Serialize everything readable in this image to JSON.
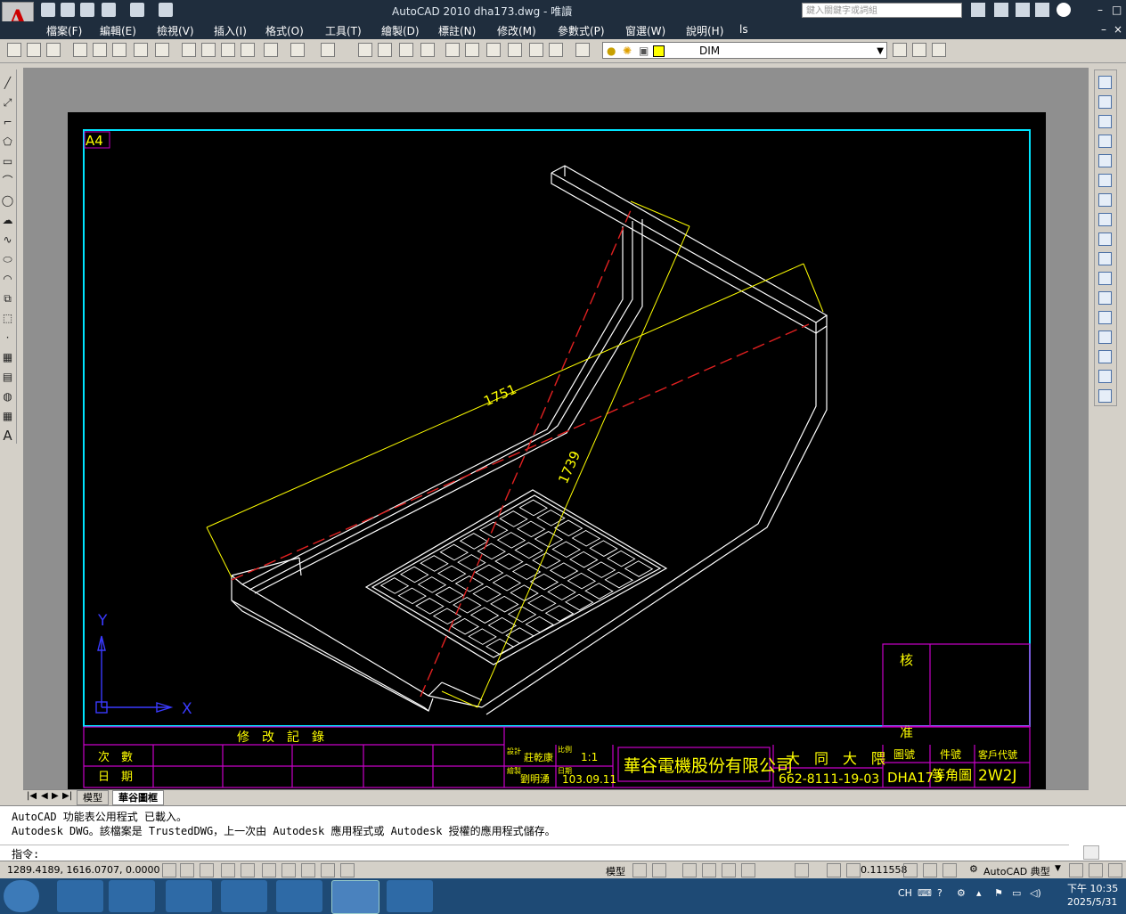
{
  "window": {
    "title": "AutoCAD 2010    dha173.dwg - 唯讀",
    "search_placeholder": "鍵入關鍵字或詞組"
  },
  "menus": [
    "檔案(F)",
    "編輯(E)",
    "檢視(V)",
    "插入(I)",
    "格式(O)",
    "工具(T)",
    "繪製(D)",
    "標註(N)",
    "修改(M)",
    "參數式(P)",
    "窗選(W)",
    "說明(H)",
    "ls"
  ],
  "layer": {
    "current": "DIM"
  },
  "drawing": {
    "sheet_label": "A4",
    "dim_1": "1751",
    "dim_2": "1739",
    "ucs_y": "Y",
    "ucs_x": "X"
  },
  "title_block": {
    "revision_header": "修　改　記　錄",
    "rev_no_label": "次　數",
    "date_label": "日　期",
    "check_label": "核",
    "approve_label": "准",
    "design_label": "設計",
    "designer": "莊乾康",
    "drawn_label": "繪製",
    "drafter": "劉明湧",
    "scale_label": "比例",
    "scale": "1:1",
    "date_small_label": "日期",
    "date": "103.09.11",
    "company": "華谷電機股份有限公司",
    "customer": "大　同　大　隈",
    "part_code": "662-8111-19-03",
    "drawing_no_label": "圖號",
    "drawing_no": "DHA173",
    "item_label": "件號",
    "item": "等角圖",
    "cust_code_label": "客戶代號",
    "cust_code": "2W2J"
  },
  "tabs": [
    "模型",
    "華谷圖框"
  ],
  "command": {
    "lines": [
      "AutoCAD 功能表公用程式 已載入。",
      "Autodesk DWG。該檔案是 TrustedDWG，上一次由 Autodesk 應用程式或 Autodesk 授權的應用程式儲存。"
    ],
    "prompt": "指令:"
  },
  "status": {
    "coords": "1289.4189, 1616.0707, 0.0000",
    "space": "模型",
    "scale": "0.111558",
    "workspace": "AutoCAD 典型"
  },
  "taskbar": {
    "lang": "CH",
    "time": "下午 10:35",
    "date": "2025/5/31"
  },
  "colors": {
    "sheet": "#000000",
    "frame_cyan": "#00e5ff",
    "title_block_magenta": "#c800c8",
    "text_yellow": "#ffff00",
    "model_white": "#ffffff",
    "centerline_red": "#e02020"
  }
}
